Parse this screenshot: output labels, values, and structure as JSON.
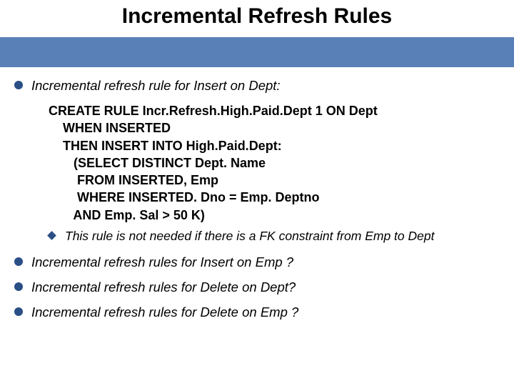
{
  "title": "Incremental Refresh Rules",
  "bullets": {
    "b1": "Incremental refresh rule for Insert on Dept:",
    "b2": "Incremental refresh rules for Insert on Emp ?",
    "b3": "Incremental refresh rules for Delete on Dept?",
    "b4": "Incremental refresh rules for Delete on Emp ?"
  },
  "code": {
    "l1": "CREATE RULE Incr.Refresh.High.Paid.Dept 1 ON Dept",
    "l2": "    WHEN INSERTED",
    "l3": "    THEN INSERT INTO High.Paid.Dept:",
    "l4": "       (SELECT DISTINCT Dept. Name",
    "l5": "        FROM INSERTED, Emp",
    "l6": "        WHERE INSERTED. Dno = Emp. Deptno",
    "l7": "       AND Emp. Sal > 50 K)"
  },
  "sub": "This rule is not needed if there is a FK constraint from Emp to Dept"
}
